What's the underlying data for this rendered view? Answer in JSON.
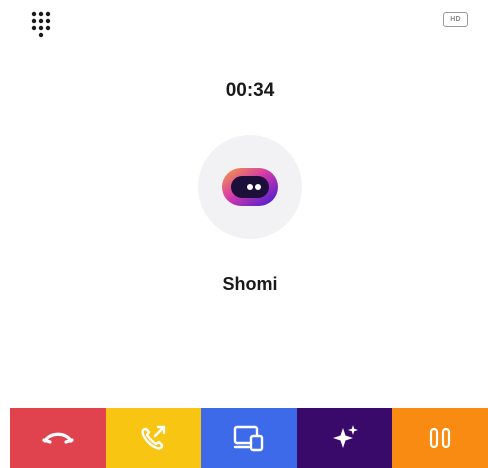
{
  "call": {
    "timer": "00:34",
    "contact_name": "Shomi",
    "quality_badge": "HD"
  },
  "icons": {
    "dialpad": "dialpad-icon",
    "avatar": "shomi-logo",
    "hangup": "phone-hangup-icon",
    "forward": "call-forward-icon",
    "switch_device": "switch-device-icon",
    "ai": "sparkle-icon",
    "hold": "pause-icon"
  },
  "colors": {
    "hangup": "#e1434e",
    "forward": "#f9c513",
    "switch_device": "#3d6ae8",
    "ai": "#3a0a6a",
    "hold": "#f98a12"
  }
}
